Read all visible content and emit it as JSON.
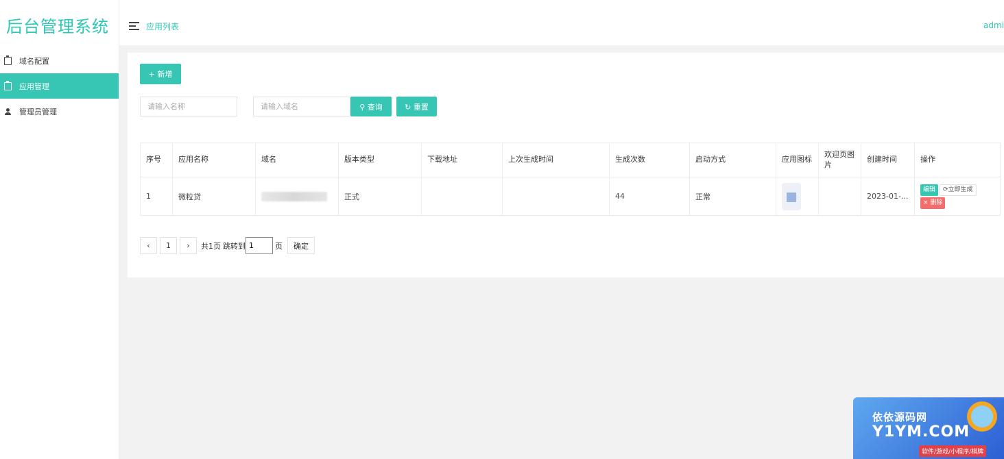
{
  "app": {
    "title": "后台管理系统"
  },
  "sidebar": {
    "items": [
      {
        "label": "域名配置",
        "icon": "clipboard-icon",
        "active": false
      },
      {
        "label": "应用管理",
        "icon": "clipboard-icon",
        "active": true
      },
      {
        "label": "管理员管理",
        "icon": "user-icon",
        "active": false
      }
    ]
  },
  "header": {
    "breadcrumb": "应用列表",
    "user": "admin"
  },
  "toolbar": {
    "add_label": "+ 新增",
    "name_placeholder": "请输入名称",
    "domain_placeholder": "请输入域名",
    "search_label": "⚲ 查询",
    "reset_label": "↻ 重置"
  },
  "table": {
    "columns": [
      "序号",
      "应用名称",
      "域名",
      "版本类型",
      "下载地址",
      "上次生成时间",
      "生成次数",
      "启动方式",
      "应用图标",
      "欢迎页图片",
      "创建时间",
      "操作"
    ],
    "rows": [
      {
        "index": "1",
        "name": "微粒贷",
        "domain": "",
        "version": "正式",
        "download": "",
        "last_gen": "",
        "gen_count": "44",
        "launch": "正常",
        "welcome": "",
        "created": "2023-01-...",
        "actions": {
          "edit": "编辑",
          "generate": "⟳立即生成",
          "delete": "× 删除"
        }
      }
    ]
  },
  "pagination": {
    "prev": "‹",
    "current": "1",
    "next": "›",
    "total_text": "共1页",
    "jump_text": "跳转到",
    "jump_value": "1",
    "page_unit": "页",
    "confirm": "确定"
  },
  "watermark": {
    "line1": "依依源码网",
    "line2": "Y1YM.COM",
    "line3": "软件/游戏/小程序/棋牌"
  },
  "colors": {
    "accent": "#36c6b3",
    "danger": "#f56c6c"
  }
}
